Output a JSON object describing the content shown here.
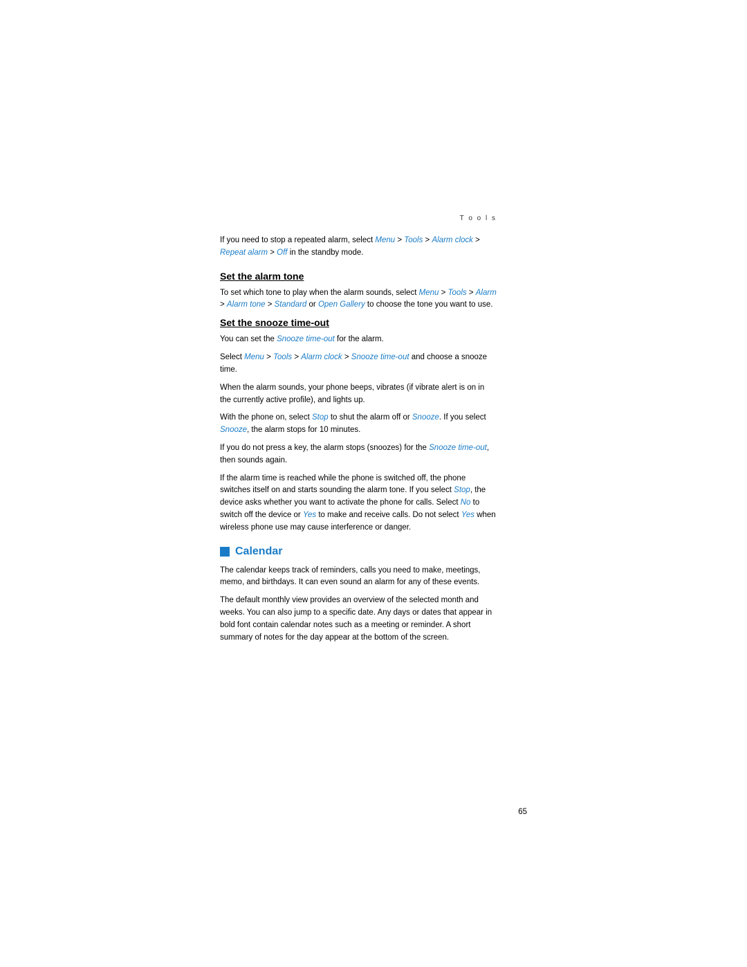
{
  "section_label": "T o o l s",
  "intro": {
    "text_before": "If you need to stop a repeated alarm, select ",
    "link1": "Menu",
    "sep1": " > ",
    "link2": "Tools",
    "sep2": " > ",
    "link3": "Alarm clock",
    "sep3": " > ",
    "link4": "Repeat alarm",
    "sep4": " > ",
    "link5": "Off",
    "text_after": " in the standby mode."
  },
  "alarm_tone": {
    "heading": "Set the alarm tone",
    "text_before": "To set which tone to play when the alarm sounds, select ",
    "link1": "Menu",
    "sep1": " > ",
    "link2": "Tools",
    "sep2": " > ",
    "link3": "Alarm",
    "sep3": " > ",
    "link4": "Alarm tone",
    "sep4": " > ",
    "link5": "Standard",
    "text_mid": " or ",
    "link6": "Open Gallery",
    "text_after": " to choose the tone you want to use."
  },
  "snooze_timeout": {
    "heading": "Set the snooze time-out",
    "para1_before": "You can set the ",
    "para1_link": "Snooze time-out",
    "para1_after": " for the alarm.",
    "para2_before": "Select ",
    "para2_link1": "Menu",
    "para2_sep1": " > ",
    "para2_link2": "Tools",
    "para2_sep2": " > ",
    "para2_link3": "Alarm clock",
    "para2_sep3": " > ",
    "para2_link4": "Snooze time-out",
    "para2_after": " and choose a snooze time.",
    "para3": "When the alarm sounds, your phone beeps, vibrates (if vibrate alert is on in the currently active profile), and lights up.",
    "para4_before": "With the phone on, select ",
    "para4_link1": "Stop",
    "para4_mid": " to shut the alarm off or ",
    "para4_link2": "Snooze",
    "para4_after": ". If you select ",
    "para4_link3": "Snooze",
    "para4_after2": ", the alarm stops for 10 minutes.",
    "para5_before": "If you do not press a key, the alarm stops (snoozes) for the ",
    "para5_link": "Snooze time-out",
    "para5_after": ", then sounds again.",
    "para6_before": "If the alarm time is reached while the phone is switched off, the phone switches itself on and starts sounding the alarm tone. If you select ",
    "para6_link1": "Stop",
    "para6_mid": ", the device asks whether you want to activate the phone for calls. Select ",
    "para6_link2": "No",
    "para6_mid2": " to switch off the device or ",
    "para6_link3": "Yes",
    "para6_mid3": " to make and receive calls. Do not select ",
    "para6_link4": "Yes",
    "para6_after": " when wireless phone use may cause interference or danger."
  },
  "calendar": {
    "heading": "Calendar",
    "icon_label": "calendar-square-icon",
    "para1": "The calendar keeps track of reminders, calls you need to make, meetings, memo, and birthdays. It can even sound an alarm for any of these events.",
    "para2": "The default monthly view provides an overview of the selected month and weeks. You can also jump to a specific date. Any days or dates that appear in bold font contain calendar notes such as a meeting or reminder. A short summary of notes for the day appear at the bottom of the screen."
  },
  "page_number": "65",
  "colors": {
    "link": "#1a7cc7",
    "text": "#000000",
    "heading_underline": "#000000",
    "calendar_blue": "#1a7cc7"
  }
}
